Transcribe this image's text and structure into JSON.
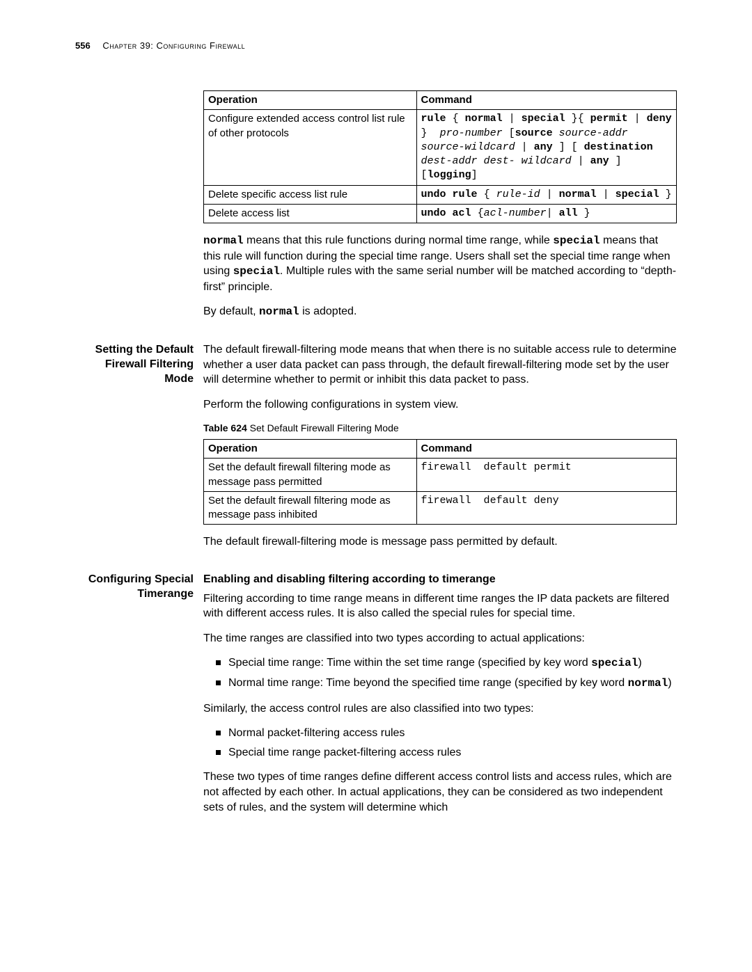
{
  "header": {
    "page_number": "556",
    "chapter": "Chapter 39: Configuring Firewall"
  },
  "table1": {
    "h_op": "Operation",
    "h_cmd": "Command",
    "r1_op": "Configure extended access control list rule of other protocols",
    "r1_cmd": "rule { normal | special }{ permit | deny }  pro-number [source source-addr source-wildcard | any ] [ destination dest-addr dest- wildcard | any ] [logging]",
    "r2_op": "Delete specific access list rule",
    "r2_cmd": "undo rule { rule-id | normal | special }",
    "r3_op": "Delete access list",
    "r3_cmd": "undo acl {acl-number| all }"
  },
  "para1_a": " means that this rule functions during normal time range, while ",
  "para1_b": " means that this rule will function during the special time range. Users shall set the special time range when using ",
  "para1_c": ". Multiple rules with the same serial number will be matched according to “depth-first” principle.",
  "kw_normal": "normal",
  "kw_special": "special",
  "para2_a": "By default, ",
  "para2_b": " is adopted.",
  "side2": "Setting the Default Firewall Filtering Mode",
  "p_default1": "The default firewall-filtering mode means that when there is no suitable access rule to determine whether a user data packet can pass through, the default firewall-filtering mode set by the user will determine whether to permit or inhibit this data packet to pass.",
  "p_default2": "Perform the following configurations in system view.",
  "caption2_a": "Table 624",
  "caption2_b": "   Set Default Firewall Filtering Mode",
  "table2": {
    "h_op": "Operation",
    "h_cmd": "Command",
    "r1_op": "Set the default firewall filtering mode as message pass permitted",
    "r1_cmd": "firewall  default permit",
    "r2_op": "Set the default firewall filtering mode as message pass inhibited",
    "r2_cmd": "firewall  default deny"
  },
  "p_default3": "The default firewall-filtering mode is message pass permitted by default.",
  "side3": "Configuring Special Timerange",
  "subhead3": "Enabling and disabling filtering according to timerange",
  "p_tr1": "Filtering according to time range means in different time ranges the IP data packets are filtered with different access rules. It is also called the special rules for special time.",
  "p_tr2": "The time ranges are classified into two types according to actual applications:",
  "li1_a": "Special time range: Time within the set time range (specified by key word ",
  "li1_b": ")",
  "li2_a": "Normal time range: Time beyond the specified time range (specified by key word ",
  "li2_b": ")",
  "p_tr3": "Similarly, the access control rules are also classified into two types:",
  "li3": "Normal packet-filtering access rules",
  "li4": "Special time range packet-filtering access rules",
  "p_tr4": "These two types of time ranges define different access control lists and access rules, which are not affected by each other. In actual applications, they can be considered as two independent sets of rules, and the system will determine which"
}
